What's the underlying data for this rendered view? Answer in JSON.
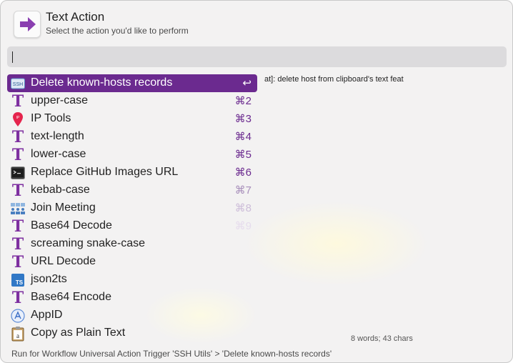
{
  "header": {
    "title": "Text Action",
    "subtitle": "Select the action you'd like to perform"
  },
  "search": {
    "value": ""
  },
  "actions": [
    {
      "label": "Delete known-hosts records",
      "shortcut": "↩",
      "icon": "ssh-icon"
    },
    {
      "label": "upper-case",
      "shortcut": "⌘2",
      "icon": "text-t-icon"
    },
    {
      "label": "IP Tools",
      "shortcut": "⌘3",
      "icon": "ip-pin-icon"
    },
    {
      "label": "text-length",
      "shortcut": "⌘4",
      "icon": "text-t-icon"
    },
    {
      "label": "lower-case",
      "shortcut": "⌘5",
      "icon": "text-t-icon"
    },
    {
      "label": "Replace GitHub Images URL",
      "shortcut": "⌘6",
      "icon": "terminal-icon"
    },
    {
      "label": "kebab-case",
      "shortcut": "⌘7",
      "icon": "text-t-icon"
    },
    {
      "label": "Join Meeting",
      "shortcut": "⌘8",
      "icon": "people-icon"
    },
    {
      "label": "Base64 Decode",
      "shortcut": "⌘9",
      "icon": "text-t-icon"
    },
    {
      "label": "screaming snake-case",
      "shortcut": "",
      "icon": "text-t-icon"
    },
    {
      "label": "URL Decode",
      "shortcut": "",
      "icon": "text-t-icon"
    },
    {
      "label": "json2ts",
      "shortcut": "",
      "icon": "typescript-icon"
    },
    {
      "label": "Base64 Encode",
      "shortcut": "",
      "icon": "text-t-icon"
    },
    {
      "label": "AppID",
      "shortcut": "",
      "icon": "app-store-icon"
    },
    {
      "label": "Copy as Plain Text",
      "shortcut": "",
      "icon": "clipboard-icon"
    }
  ],
  "preview_text": "at]: delete host from clipboard's text feat",
  "counts": "8 words; 43 chars",
  "footer": "Run for Workflow Universal Action Trigger 'SSH Utils' > 'Delete known-hosts records'",
  "colors": {
    "accent": "#6b2a8f",
    "search_bg": "#dcdbdd",
    "window_bg": "#f3f2f2"
  }
}
